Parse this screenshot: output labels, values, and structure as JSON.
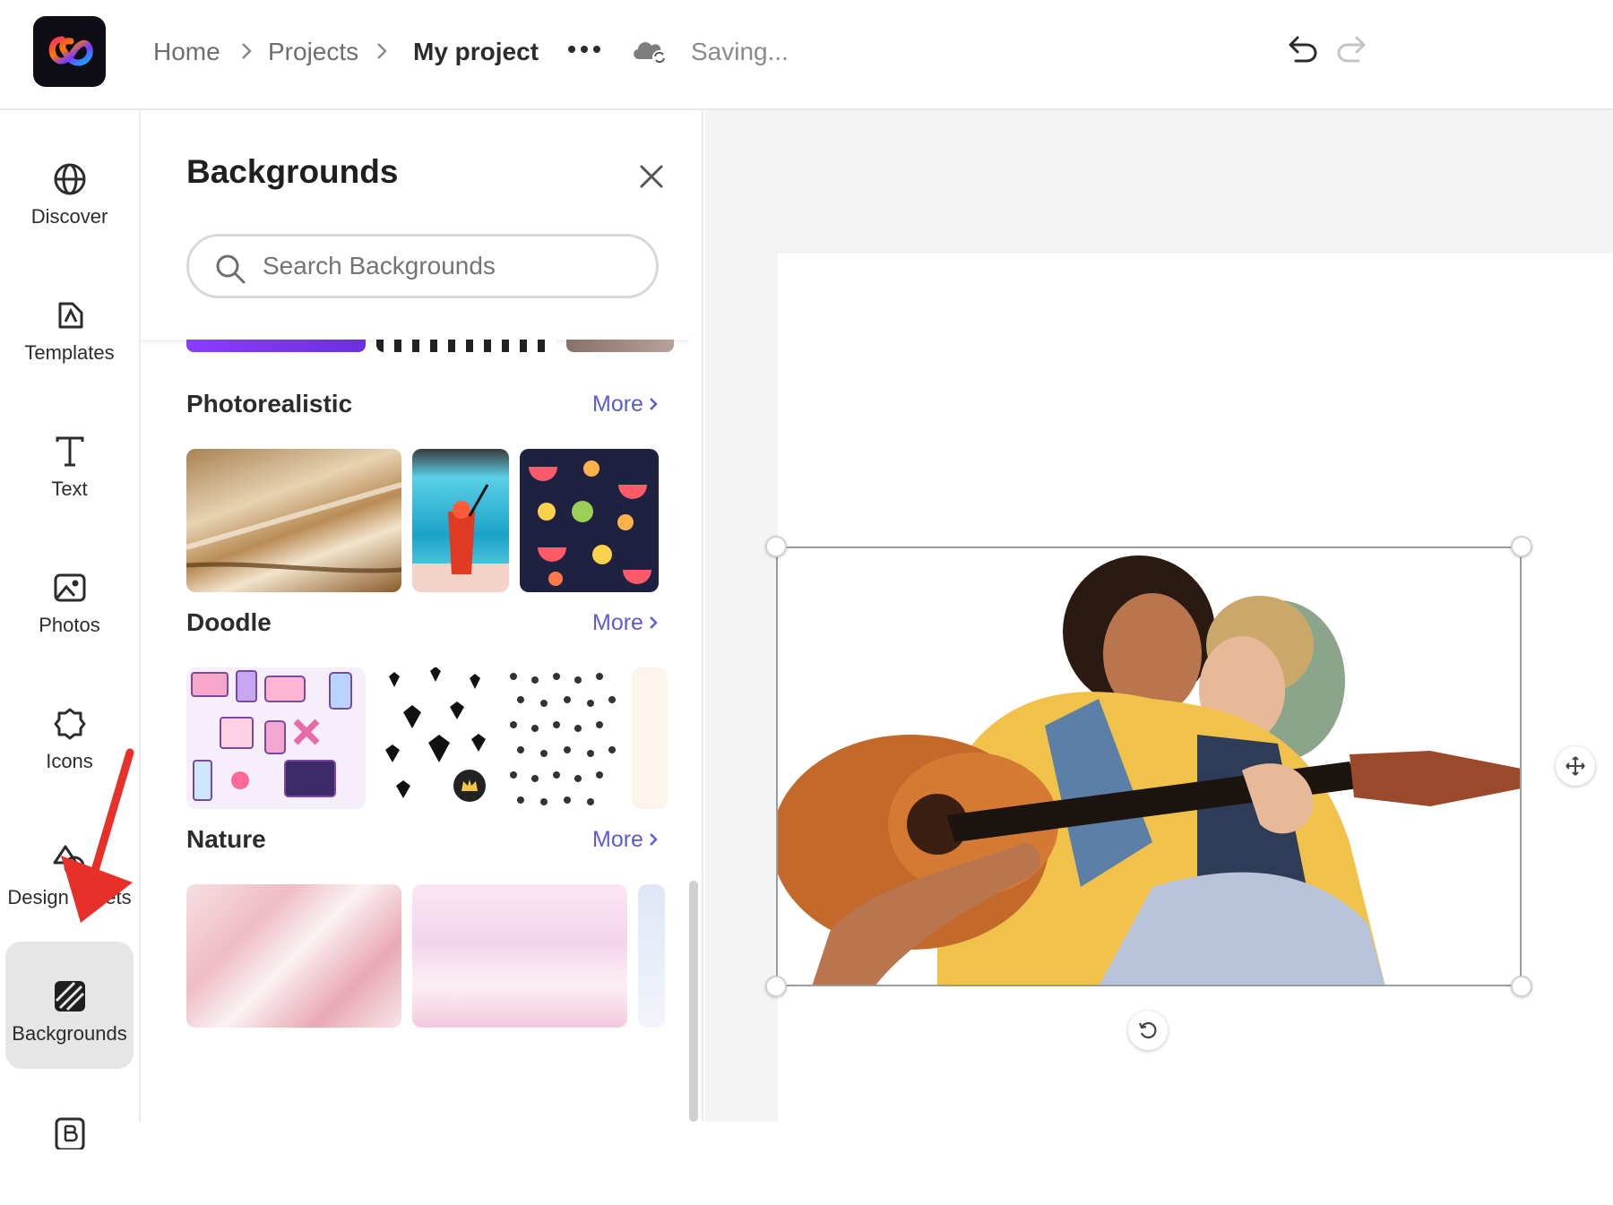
{
  "topbar": {
    "breadcrumbs": [
      "Home",
      "Projects",
      "My project"
    ],
    "status": "Saving..."
  },
  "rail": {
    "items": [
      {
        "label": "Discover"
      },
      {
        "label": "Templates"
      },
      {
        "label": "Text"
      },
      {
        "label": "Photos"
      },
      {
        "label": "Icons"
      },
      {
        "label": "Design assets"
      },
      {
        "label": "Backgrounds"
      }
    ]
  },
  "panel": {
    "title": "Backgrounds",
    "search_placeholder": "Search Backgrounds",
    "categories": [
      {
        "title": "Photorealistic",
        "more": "More"
      },
      {
        "title": "Doodle",
        "more": "More"
      },
      {
        "title": "Nature",
        "more": "More"
      }
    ]
  },
  "colors": {
    "accent_link": "#5b5bd6",
    "arrow_annotation": "#e8302a",
    "active_rail_bg": "#e6e6e6"
  }
}
